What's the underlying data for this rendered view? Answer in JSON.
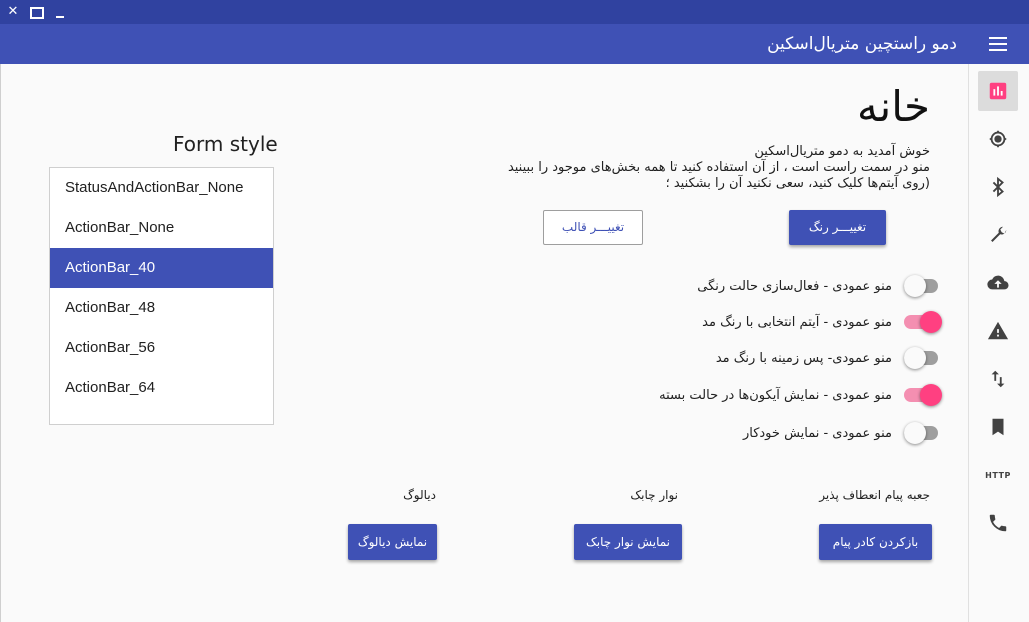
{
  "window": {
    "close_glyph": "✕"
  },
  "toolbar": {
    "title": "دمو راستچین متریال‌اسکین",
    "menu_icon": "hamburger-icon"
  },
  "form_style": {
    "title": "Form style",
    "items": [
      "StatusAndActionBar_None",
      "ActionBar_None",
      "ActionBar_40",
      "ActionBar_48",
      "ActionBar_56",
      "ActionBar_64"
    ],
    "selected": "ActionBar_40"
  },
  "home": {
    "title": "خانه",
    "description": [
      "خوش آمدید به دمو متریال‌اسکین",
      "منو در سمت راست است ، از آن استفاده کنید تا همه بخش‌های موجود را ببینید",
      "(روی آیتم‌ها کلیک کنید، سعی نکنید آن را بشکنید ؛"
    ],
    "change_color_label": "تغییـــر رنگ",
    "change_theme_label": "تغییـــر قالب"
  },
  "switches": [
    {
      "label": "منو عمودی - فعال‌سازی حالت رنگی",
      "on": false
    },
    {
      "label": "منو عمودی - آیتم انتخابی با رنگ مد",
      "on": true
    },
    {
      "label": "منو عمودی- پس زمینه با رنگ مد",
      "on": false
    },
    {
      "label": "منو عمودی - نمایش آیکون‌ها در حالت بسته",
      "on": true
    },
    {
      "label": "منو عمودی - نمایش خودکار",
      "on": false
    }
  ],
  "sections": {
    "messagebox": {
      "label": "جعبه پیام انعطاف پذیر",
      "button": "بازکردن کادر پیام"
    },
    "snackbar": {
      "label": "نوار چابک",
      "button": "نمایش نوار چابک"
    },
    "dialog": {
      "label": "دیالوگ",
      "button": "نمایش دیالوگ"
    }
  },
  "rail": {
    "items": [
      "chart-icon",
      "gps-icon",
      "bluetooth-icon",
      "wrench-icon",
      "cloud-upload-icon",
      "warning-icon",
      "swap-vertical-icon",
      "bookmark-icon",
      "http-icon",
      "phone-icon"
    ],
    "http_text": "HTTP",
    "active": "chart-icon",
    "active_color": "#ff4081"
  },
  "colors": {
    "primary": "#3f51b5",
    "accent": "#ff4081"
  }
}
